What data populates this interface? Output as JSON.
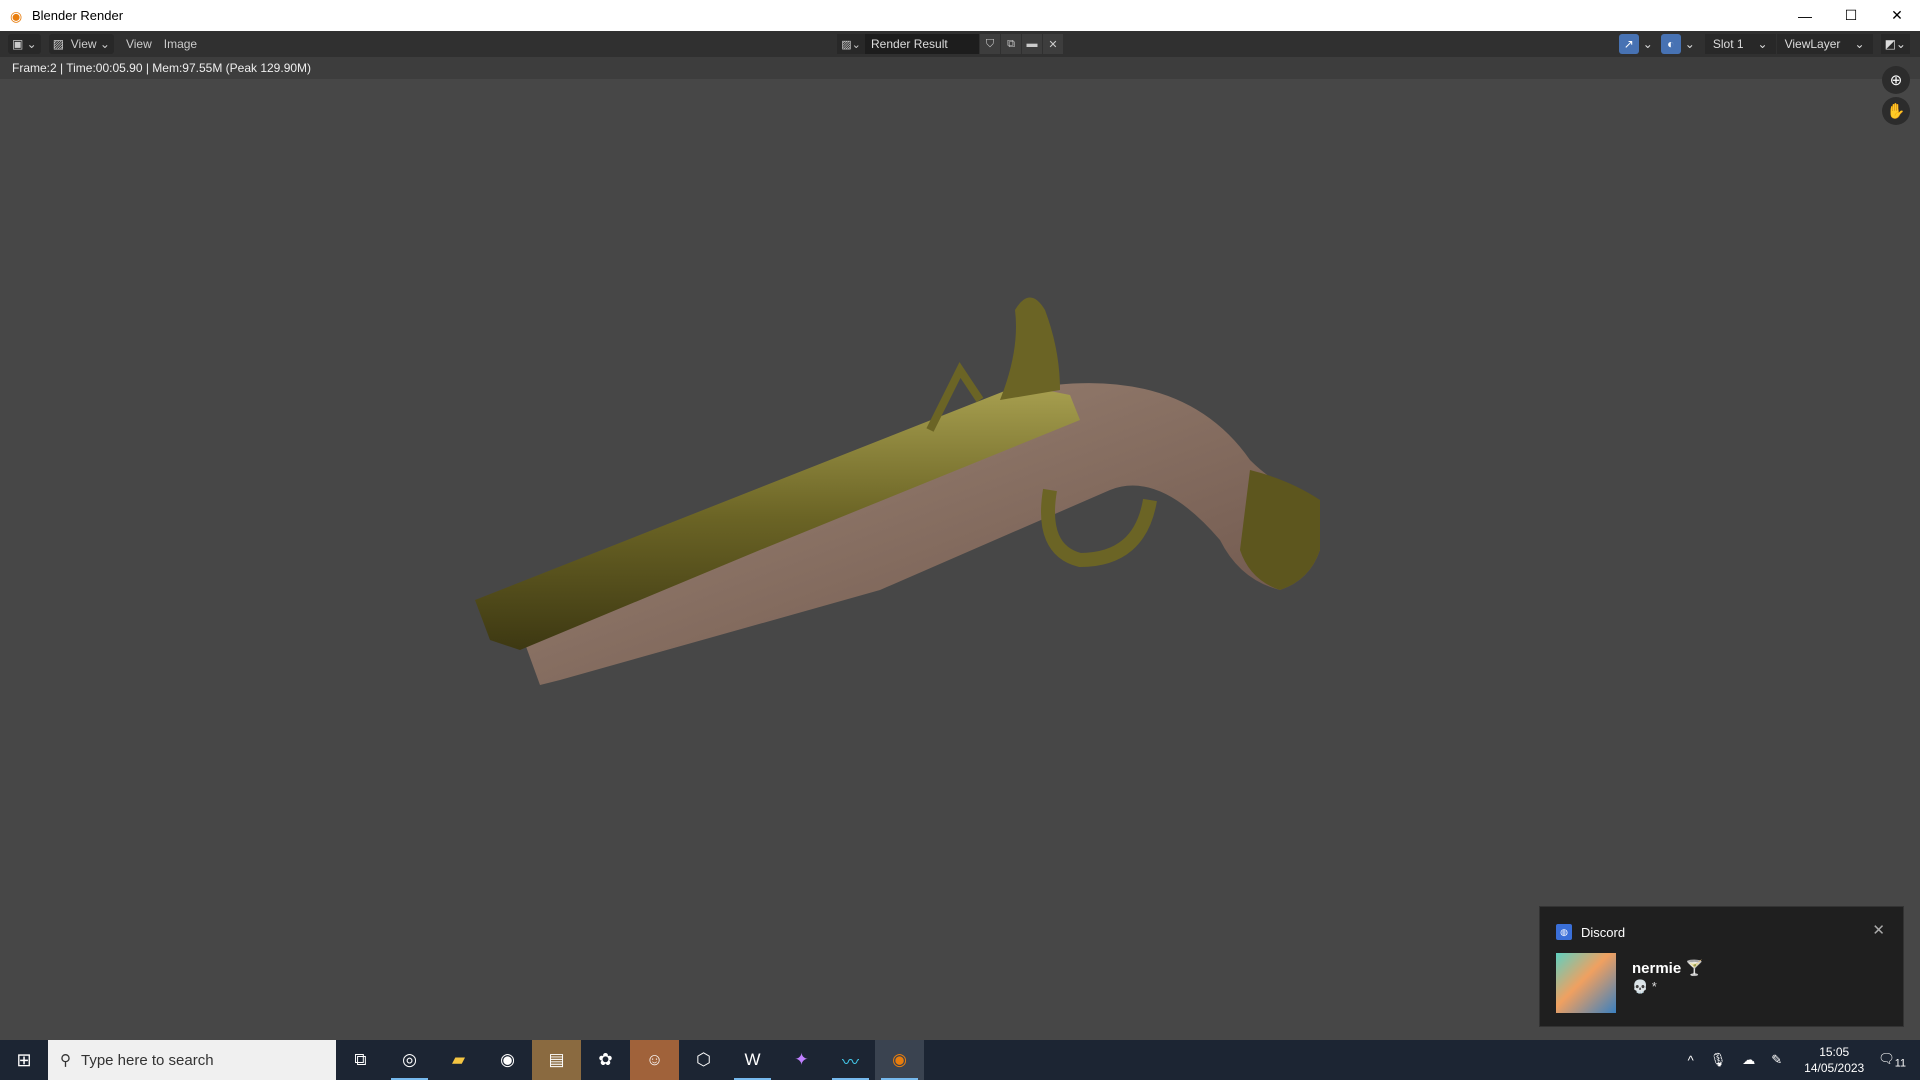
{
  "window": {
    "title": "Blender Render",
    "minimize": "—",
    "maximize": "☐",
    "close": "✕"
  },
  "header": {
    "editor_type": "▣",
    "view_dropdown": "View",
    "menus": [
      "View",
      "Image"
    ],
    "image_name": "Render Result",
    "slot": "Slot 1",
    "view_layer": "ViewLayer"
  },
  "status": "Frame:2 | Time:00:05.90 | Mem:97.55M (Peak 129.90M)",
  "taskbar": {
    "search_placeholder": "Type here to search",
    "time": "15:05",
    "date": "14/05/2023",
    "notifications": "11"
  },
  "toast": {
    "app": "Discord",
    "user": "nermie 🍸",
    "message": "💀 *"
  },
  "colors": {
    "viewport": "#474747",
    "header": "#303030",
    "accent": "#4772b3"
  }
}
